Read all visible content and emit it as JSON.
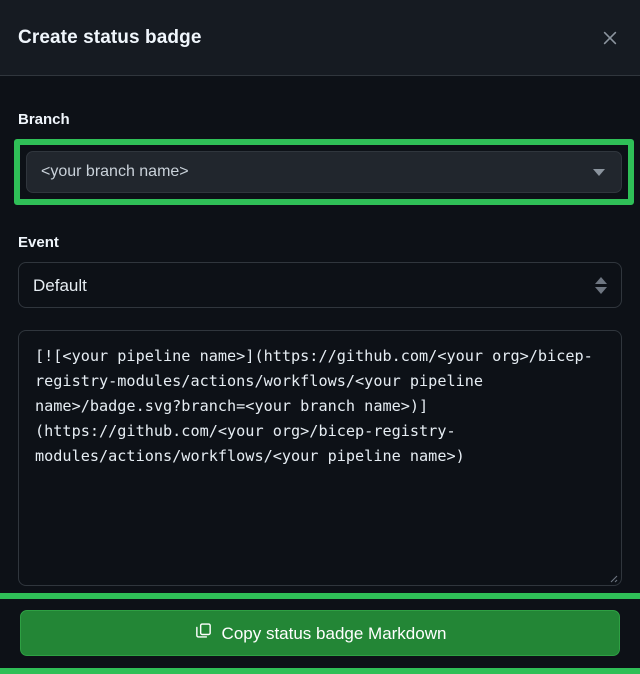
{
  "dialog": {
    "title": "Create status badge",
    "close_icon": "close-icon",
    "close_label": "×"
  },
  "branch": {
    "label": "Branch",
    "value": "<your branch name>",
    "caret_icon": "chevron-down-icon"
  },
  "event": {
    "label": "Event",
    "value": "Default",
    "stepper_icon": "chevron-up-down-icon"
  },
  "markdown": {
    "value": "[![<your pipeline name>](https://github.com/<your org>/bicep-registry-modules/actions/workflows/<your pipeline name>/badge.svg?branch=<your branch name>)](https://github.com/<your org>/bicep-registry-modules/actions/workflows/<your pipeline name>)",
    "resize_handle": "resize-grip"
  },
  "footer": {
    "copy_label": "Copy status badge Markdown",
    "copy_icon": "copy-icon"
  },
  "colors": {
    "background": "#0d1117",
    "header_background": "#161b22",
    "border": "#30363d",
    "text": "#e6edf3",
    "muted_text": "#c9d1d9",
    "accent_green": "#238636",
    "highlight_green": "#2fbf57",
    "field_background": "#21262d"
  }
}
